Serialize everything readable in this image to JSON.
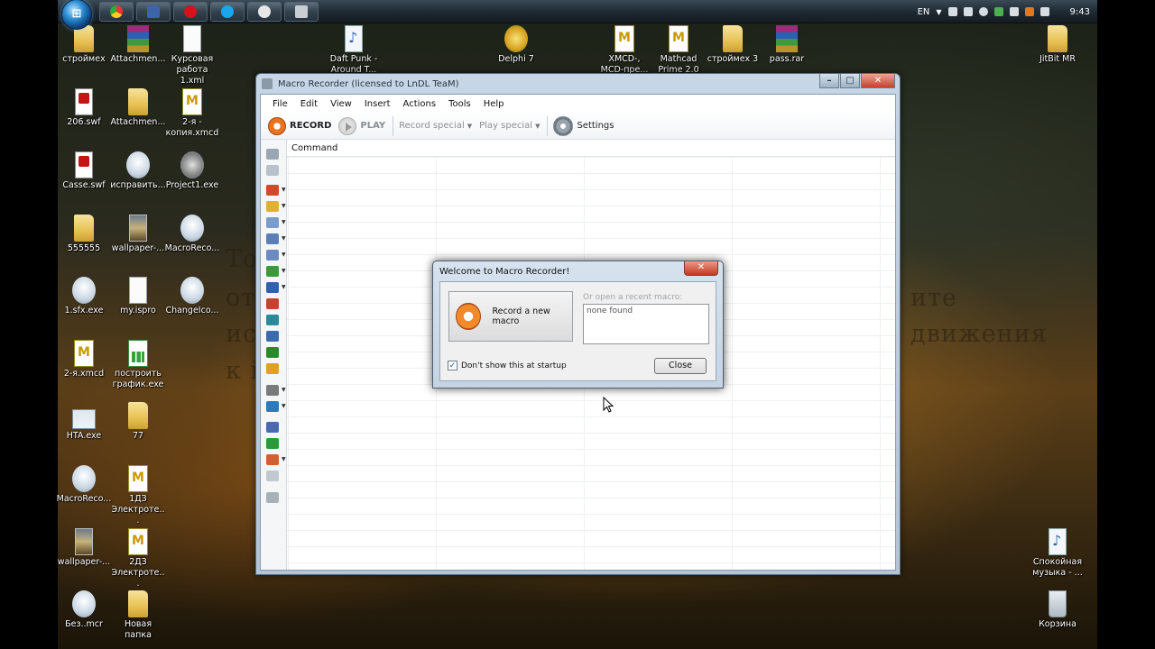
{
  "taskbar": {
    "language": "EN",
    "clock": "9:43",
    "buttons": [
      "chrome",
      "save",
      "opera",
      "skype",
      "app",
      "macro-recorder"
    ]
  },
  "wallpaper_text": [
    "То",
    "от",
    "ис",
    "к і",
    "ите",
    "движения"
  ],
  "desktop_icons": [
    {
      "label": "строймех",
      "kind": "folder"
    },
    {
      "label": "Attachmen...",
      "kind": "rar"
    },
    {
      "label": "Курсовая работа 1.xml",
      "kind": "doc"
    },
    {
      "label": "Daft Punk - Around T...",
      "kind": "music"
    },
    {
      "label": "Delphi 7",
      "kind": "delphi"
    },
    {
      "label": "XMCD-, MCD-пре...",
      "kind": "mcd"
    },
    {
      "label": "Mathcad Prime 2.0",
      "kind": "mcd"
    },
    {
      "label": "строймех 3",
      "kind": "folder"
    },
    {
      "label": "pass.rar",
      "kind": "rar"
    },
    {
      "label": "JitBit MR",
      "kind": "folder"
    },
    {
      "label": "206.swf",
      "kind": "swf"
    },
    {
      "label": "Attachmen...",
      "kind": "folder"
    },
    {
      "label": "2-я - копия.xmcd",
      "kind": "mcd"
    },
    {
      "label": "Casse.swf",
      "kind": "swf"
    },
    {
      "label": "исправить...",
      "kind": "exe"
    },
    {
      "label": "Project1.exe",
      "kind": "gear"
    },
    {
      "label": "555555",
      "kind": "folder"
    },
    {
      "label": "wallpaper-...",
      "kind": "photo"
    },
    {
      "label": "MacroReco...",
      "kind": "exe"
    },
    {
      "label": "1.sfx.exe",
      "kind": "exe"
    },
    {
      "label": "my.ispro",
      "kind": "doc"
    },
    {
      "label": "ChangeIco...",
      "kind": "exe"
    },
    {
      "label": "2-я.xmcd",
      "kind": "mcd"
    },
    {
      "label": "построить график.exe",
      "kind": "xlsx"
    },
    {
      "label": "HTA.exe",
      "kind": "hta"
    },
    {
      "label": "77",
      "kind": "folder"
    },
    {
      "label": "MacroReco...",
      "kind": "exe"
    },
    {
      "label": "1ДЗ Электроте...",
      "kind": "mcd"
    },
    {
      "label": "wallpaper-...",
      "kind": "photo"
    },
    {
      "label": "2ДЗ Электроте...",
      "kind": "mcd"
    },
    {
      "label": "Без..mcr",
      "kind": "exe"
    },
    {
      "label": "Новая папка",
      "kind": "folder"
    },
    {
      "label": "Спокойная музыка - ...",
      "kind": "music"
    },
    {
      "label": "Корзина",
      "kind": "bin"
    }
  ],
  "main_window": {
    "title": "Macro Recorder (licensed to LnDL TeaM)",
    "controls": {
      "minimize": "–",
      "maximize": "□",
      "close": "✕"
    },
    "menu": [
      "File",
      "Edit",
      "View",
      "Insert",
      "Actions",
      "Tools",
      "Help"
    ],
    "toolbar": {
      "record": "RECORD",
      "play": "PLAY",
      "record_special": "Record special",
      "play_special": "Play special",
      "settings": "Settings"
    },
    "grid": {
      "column_header": "Command"
    }
  },
  "welcome_dialog": {
    "title": "Welcome to Macro Recorder!",
    "close_glyph": "✕",
    "new_macro_label": "Record a new macro",
    "recent_label": "Or open a recent macro:",
    "recent_empty": "none found",
    "startup_checkbox_label": "Don't show this at startup",
    "startup_checked": true,
    "check_glyph": "✓",
    "close_button": "Close"
  },
  "colors": {
    "record_orange": "#e8741f",
    "window_frame": "#c7d6e6",
    "close_red": "#c6402c"
  }
}
